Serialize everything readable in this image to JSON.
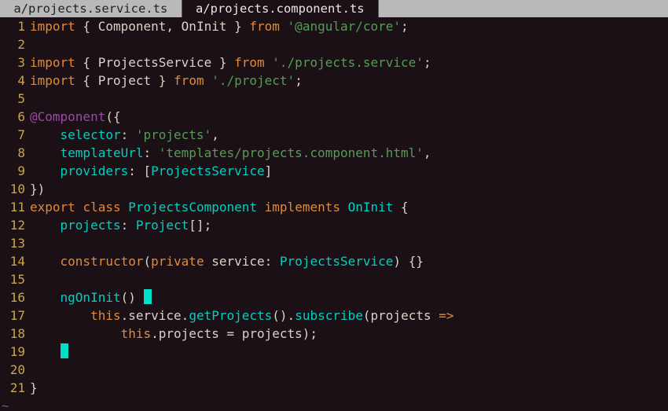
{
  "tabs": [
    {
      "label": " a/projects.service.ts ",
      "active": false
    },
    {
      "label": " a/projects.component.ts ",
      "active": true
    }
  ],
  "lines": [
    {
      "n": "1",
      "tk": [
        {
          "c": "kw",
          "t": "import"
        },
        {
          "c": "punct",
          "t": " { "
        },
        {
          "c": "ident",
          "t": "Component"
        },
        {
          "c": "punct",
          "t": ", "
        },
        {
          "c": "ident",
          "t": "OnInit"
        },
        {
          "c": "punct",
          "t": " } "
        },
        {
          "c": "kw",
          "t": "from"
        },
        {
          "c": "punct",
          "t": " "
        },
        {
          "c": "str",
          "t": "'@angular/core'"
        },
        {
          "c": "punct",
          "t": ";"
        }
      ]
    },
    {
      "n": "2",
      "tk": []
    },
    {
      "n": "3",
      "tk": [
        {
          "c": "kw",
          "t": "import"
        },
        {
          "c": "punct",
          "t": " { "
        },
        {
          "c": "ident",
          "t": "ProjectsService"
        },
        {
          "c": "punct",
          "t": " } "
        },
        {
          "c": "kw",
          "t": "from"
        },
        {
          "c": "punct",
          "t": " "
        },
        {
          "c": "str",
          "t": "'./projects.service'"
        },
        {
          "c": "punct",
          "t": ";"
        }
      ]
    },
    {
      "n": "4",
      "tk": [
        {
          "c": "kw",
          "t": "import"
        },
        {
          "c": "punct",
          "t": " { "
        },
        {
          "c": "ident",
          "t": "Project"
        },
        {
          "c": "punct",
          "t": " } "
        },
        {
          "c": "kw",
          "t": "from"
        },
        {
          "c": "punct",
          "t": " "
        },
        {
          "c": "str",
          "t": "'./project'"
        },
        {
          "c": "punct",
          "t": ";"
        }
      ]
    },
    {
      "n": "5",
      "tk": []
    },
    {
      "n": "6",
      "tk": [
        {
          "c": "decor",
          "t": "@Component"
        },
        {
          "c": "punct",
          "t": "({"
        }
      ]
    },
    {
      "n": "7",
      "tk": [
        {
          "c": "punct",
          "t": "    "
        },
        {
          "c": "prop",
          "t": "selector"
        },
        {
          "c": "punct",
          "t": ": "
        },
        {
          "c": "str",
          "t": "'projects'"
        },
        {
          "c": "punct",
          "t": ","
        }
      ]
    },
    {
      "n": "8",
      "tk": [
        {
          "c": "punct",
          "t": "    "
        },
        {
          "c": "prop",
          "t": "templateUrl"
        },
        {
          "c": "punct",
          "t": ": "
        },
        {
          "c": "str",
          "t": "'templates/projects.component.html'"
        },
        {
          "c": "punct",
          "t": ","
        }
      ]
    },
    {
      "n": "9",
      "tk": [
        {
          "c": "punct",
          "t": "    "
        },
        {
          "c": "prop",
          "t": "providers"
        },
        {
          "c": "punct",
          "t": ": ["
        },
        {
          "c": "type",
          "t": "ProjectsService"
        },
        {
          "c": "punct",
          "t": "]"
        }
      ]
    },
    {
      "n": "10",
      "tk": [
        {
          "c": "punct",
          "t": "})"
        }
      ]
    },
    {
      "n": "11",
      "tk": [
        {
          "c": "kw",
          "t": "export"
        },
        {
          "c": "punct",
          "t": " "
        },
        {
          "c": "kw",
          "t": "class"
        },
        {
          "c": "punct",
          "t": " "
        },
        {
          "c": "type",
          "t": "ProjectsComponent"
        },
        {
          "c": "punct",
          "t": " "
        },
        {
          "c": "kw",
          "t": "implements"
        },
        {
          "c": "punct",
          "t": " "
        },
        {
          "c": "type",
          "t": "OnInit"
        },
        {
          "c": "punct",
          "t": " {"
        }
      ]
    },
    {
      "n": "12",
      "tk": [
        {
          "c": "punct",
          "t": "    "
        },
        {
          "c": "prop",
          "t": "projects"
        },
        {
          "c": "punct",
          "t": ": "
        },
        {
          "c": "type",
          "t": "Project"
        },
        {
          "c": "punct",
          "t": "[];"
        }
      ]
    },
    {
      "n": "13",
      "tk": []
    },
    {
      "n": "14",
      "tk": [
        {
          "c": "punct",
          "t": "    "
        },
        {
          "c": "kw2",
          "t": "constructor"
        },
        {
          "c": "punct",
          "t": "("
        },
        {
          "c": "kw2",
          "t": "private"
        },
        {
          "c": "punct",
          "t": " "
        },
        {
          "c": "ident",
          "t": "service"
        },
        {
          "c": "punct",
          "t": ": "
        },
        {
          "c": "type",
          "t": "ProjectsService"
        },
        {
          "c": "punct",
          "t": ") {}"
        }
      ]
    },
    {
      "n": "15",
      "tk": []
    },
    {
      "n": "16",
      "tk": [
        {
          "c": "punct",
          "t": "    "
        },
        {
          "c": "type",
          "t": "ngOnInit"
        },
        {
          "c": "punct",
          "t": "() "
        },
        {
          "c": "cursor",
          "t": ""
        }
      ]
    },
    {
      "n": "17",
      "tk": [
        {
          "c": "punct",
          "t": "        "
        },
        {
          "c": "this",
          "t": "this"
        },
        {
          "c": "punct",
          "t": "."
        },
        {
          "c": "member",
          "t": "service"
        },
        {
          "c": "punct",
          "t": "."
        },
        {
          "c": "type",
          "t": "getProjects"
        },
        {
          "c": "punct",
          "t": "()."
        },
        {
          "c": "type",
          "t": "subscribe"
        },
        {
          "c": "punct",
          "t": "("
        },
        {
          "c": "ident",
          "t": "projects"
        },
        {
          "c": "punct",
          "t": " "
        },
        {
          "c": "arrow",
          "t": "=>"
        }
      ]
    },
    {
      "n": "18",
      "tk": [
        {
          "c": "punct",
          "t": "            "
        },
        {
          "c": "this",
          "t": "this"
        },
        {
          "c": "punct",
          "t": "."
        },
        {
          "c": "member",
          "t": "projects"
        },
        {
          "c": "punct",
          "t": " = "
        },
        {
          "c": "ident",
          "t": "projects"
        },
        {
          "c": "punct",
          "t": ");"
        }
      ]
    },
    {
      "n": "19",
      "tk": [
        {
          "c": "punct",
          "t": "    "
        },
        {
          "c": "cursor",
          "t": ""
        }
      ]
    },
    {
      "n": "20",
      "tk": []
    },
    {
      "n": "21",
      "tk": [
        {
          "c": "punct",
          "t": "}"
        }
      ]
    }
  ],
  "eob_marker": "~"
}
